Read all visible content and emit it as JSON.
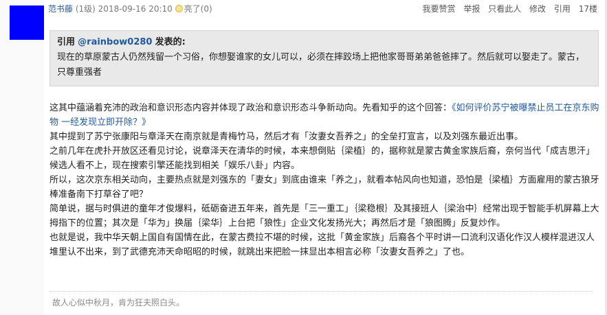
{
  "meta": {
    "author": "范书藤",
    "level": "(1级)",
    "datetime": "2018-09-16 20:10",
    "bright_label": "亮了(0)"
  },
  "actions": {
    "tip": "我要赞赏",
    "report": "举报",
    "only_author": "只看此人",
    "edit": "修改",
    "quote": "引用",
    "floor": "17楼"
  },
  "quote": {
    "prefix": "引用",
    "user": "@rainbow0280",
    "suffix": "发表的:",
    "text": "现在的草原蒙古人仍然残留一个习俗，你想娶谁家的女儿可以，必须在摔跤场上把他家哥哥弟弟爸爸摔了。然后就可以娶走了。蒙古，只尊重强者"
  },
  "body": {
    "p1_before": "这其中蕴涵着充沛的政治和意识形态内容并体现了政治和意识形态斗争新动向。先看知乎的这个回答：",
    "p1_link": "《如何评价苏宁被曝禁止员工在京东购物 一经发现立即开除？》",
    "p2": "其中提到了苏宁张康阳与章泽天在南京就是青梅竹马，然后才有「汝妻女吾养之」的全垒打宣言，以及刘强东最近出事。",
    "p3": "之前几年在虎扑开放区还看见讨论，说章泽天在清华的时候，本来想倒贴｛梁植｝的，据称就是蒙古黄金家族后裔，奈何当代「成吉思汗」候选人看不上，现在搜索引擎还能找到相关「娱乐八卦」内容。",
    "p4": "所以，这次京东相关动向，主要热点就是刘强东的「妻女」到底由谁来「养之」，就看本帖风向也知道，恐怕是｛梁植｝方面雇用的蒙古狼牙棒准备南下打草谷了吧？",
    "p5": "简单说，据与时俱进的童年才俊爆料，砥砺奋进五年来，首先是「三一重工」｛梁稳根｝及其接班人｛梁治中｝经常出现于智能手机屏幕上大拇指下的位置；其次是「华为」换届｛梁华｝上台把「狼性」企业文化发扬光大；再然后才是「狼图腾」反复炒作。",
    "p6": "也就是说，我中华天朝上国自有国情在此，在蒙古费拉不堪的时候，这批「黄金家族」后裔各个平时讲一口流利汉语化作汉人模样混进汉人堆里认不出来，到了武德充沛天命昭昭的时候，就跳出来把脸一抹显出本相言必称「汝妻女吾养之」了也。"
  },
  "signature": "故人心似中秋月，肯为狂夫照白头。"
}
